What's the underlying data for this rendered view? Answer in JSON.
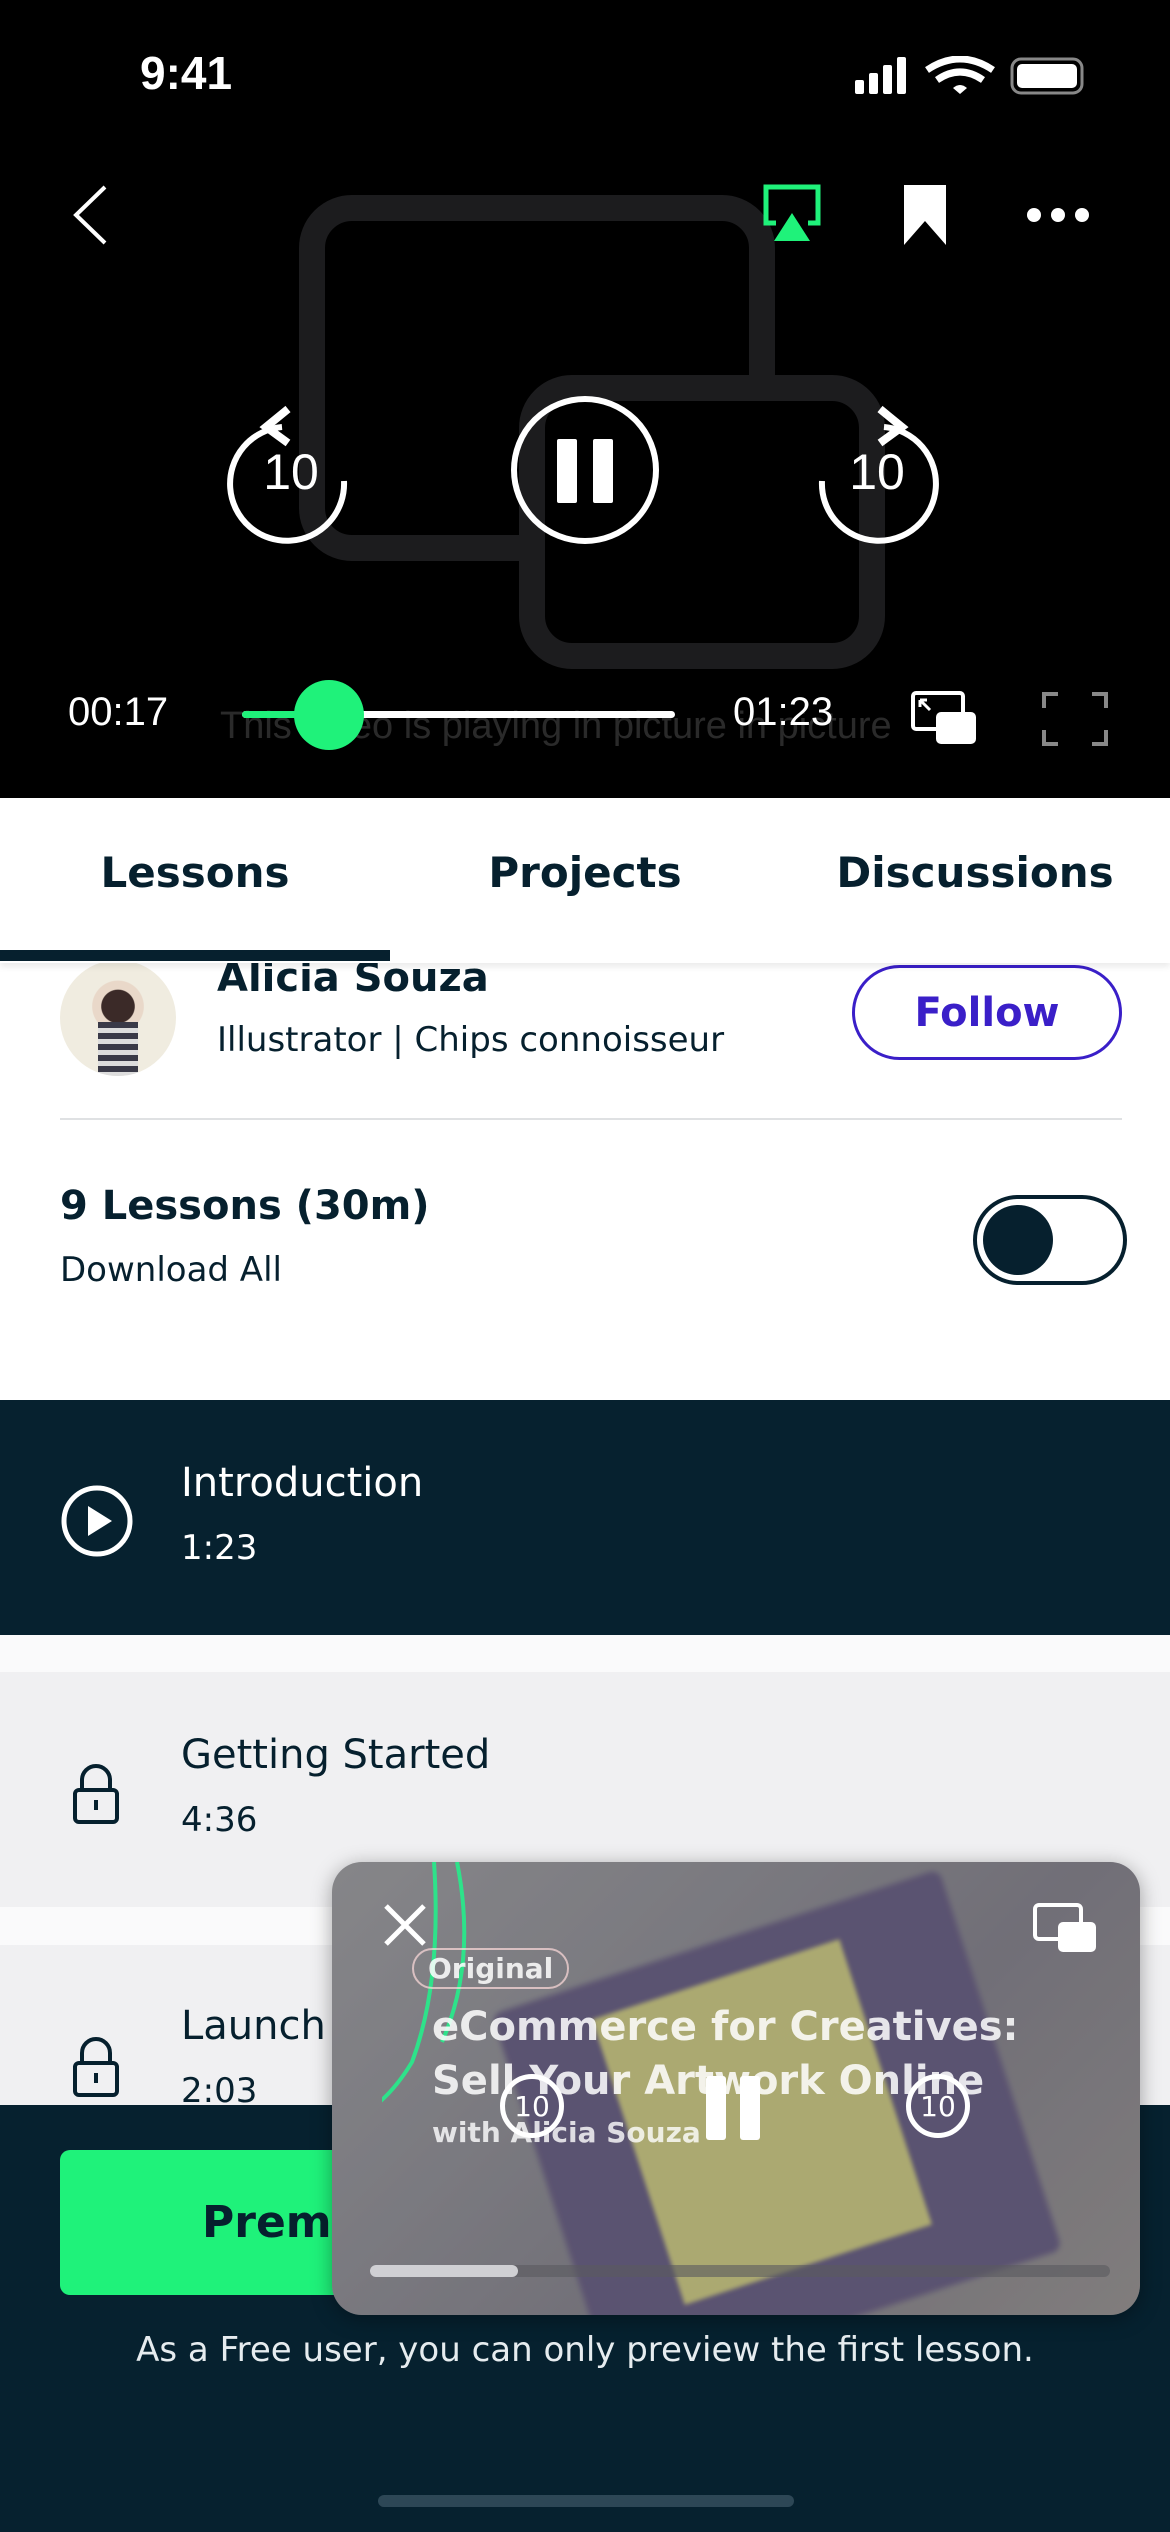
{
  "status_bar": {
    "time": "9:41"
  },
  "player": {
    "current_time": "00:17",
    "duration": "01:23",
    "progress_fraction": 0.2,
    "skip_back_seconds": "10",
    "skip_forward_seconds": "10",
    "pip_placeholder_text": "This video is playing in picture in picture",
    "accent": "#1ff27a"
  },
  "tabs": [
    {
      "label": "Lessons",
      "active": true
    },
    {
      "label": "Projects"
    },
    {
      "label": "Discussions"
    }
  ],
  "teacher": {
    "name": "Alicia Souza",
    "tagline": "Illustrator | Chips connoisseur",
    "follow_label": "Follow"
  },
  "lessons_header": {
    "title": "9 Lessons (30m)",
    "download_label": "Download All",
    "download_all_on": false
  },
  "lessons": [
    {
      "title": "Introduction",
      "duration": "1:23",
      "state": "playing"
    },
    {
      "title": "Getting Started",
      "duration": "4:36",
      "state": "locked"
    },
    {
      "title": "Launch",
      "duration": "2:03",
      "state": "locked"
    }
  ],
  "footer": {
    "premium_label": "Premium",
    "note": "As a Free user, you can only preview the first lesson."
  },
  "pip": {
    "badge": "Original",
    "title_line1": "eCommerce for Creatives:",
    "title_line2": "Sell Your Artwork Online",
    "byline": "with Alicia Souza",
    "skip_back_seconds": "10",
    "skip_forward_seconds": "10",
    "progress_fraction": 0.2
  }
}
